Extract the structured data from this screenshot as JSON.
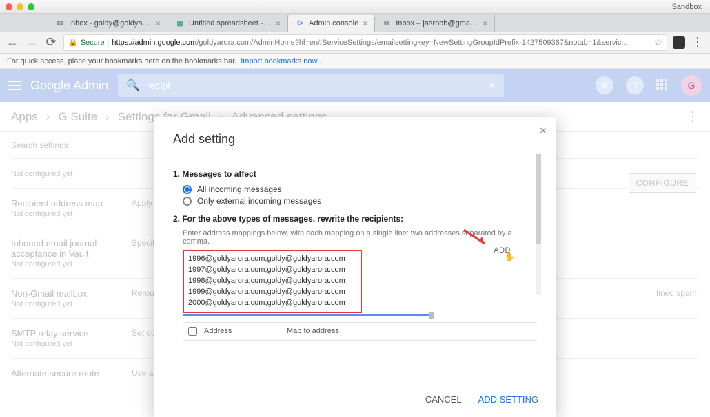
{
  "window": {
    "sandbox": "Sandbox"
  },
  "tabs": [
    {
      "title": "Inbox - goldy@goldyarora.com"
    },
    {
      "title": "Untitled spreadsheet - Google"
    },
    {
      "title": "Admin console"
    },
    {
      "title": "Inbox – jasrobb@gmail.com"
    }
  ],
  "toolbar": {
    "secure": "Secure",
    "host": "https://admin.google.com",
    "path": "/goldyarora.com/AdminHome?hl=en#ServiceSettings/emailsettingkey=NewSettingGroupIdPrefix-1427509367&notab=1&servic..."
  },
  "bookmarks": {
    "hint": "For quick access, place your bookmarks here on the bookmarks bar.",
    "import": "Import bookmarks now..."
  },
  "header": {
    "brand": "Google",
    "brand2": "Admin",
    "search_value": "recipi",
    "badge": "8",
    "avatar": "G"
  },
  "crumbs": [
    "Apps",
    "G Suite",
    "Settings for Gmail",
    "Advanced settings"
  ],
  "page": {
    "search_settings": "Search settings",
    "not_configured": "Not configured yet",
    "rows": {
      "recipient": {
        "title": "Recipient address map",
        "desc": "Apply one-t"
      },
      "journal": {
        "title": "Inbound email journal acceptance in Vault",
        "desc": "Specify a r"
      },
      "nongmail": {
        "title": "Non-Gmail mailbox",
        "desc": "Reroute me",
        "tail": "tined spam."
      },
      "smtp": {
        "title": "SMTP relay service",
        "desc": "Set options"
      },
      "altroute": {
        "title": "Alternate secure route",
        "desc": "Use alternate secure route when secure transport (TLS) is required."
      }
    },
    "configure": "CONFIGURE"
  },
  "modal": {
    "title": "Add setting",
    "s1": "1. Messages to affect",
    "opt1": "All incoming messages",
    "opt2": "Only external incoming messages",
    "s2": "2. For the above types of messages, rewrite the recipients:",
    "hint": "Enter address mappings below, with each mapping on a single line: two addresses separated by a comma.",
    "lines": [
      "1996@goldyarora.com,goldy@goldyarora.com",
      "1997@goldyarora.com,goldy@goldyarora.com",
      "1998@goldyarora.com,goldy@goldyarora.com",
      "1999@goldyarora.com,goldy@goldyarora.com",
      "2000@goldyarora.com,goldy@goldyarora.com"
    ],
    "add": "ADD",
    "col_address": "Address",
    "col_mapto": "Map to address",
    "cancel": "CANCEL",
    "submit": "ADD SETTING"
  }
}
